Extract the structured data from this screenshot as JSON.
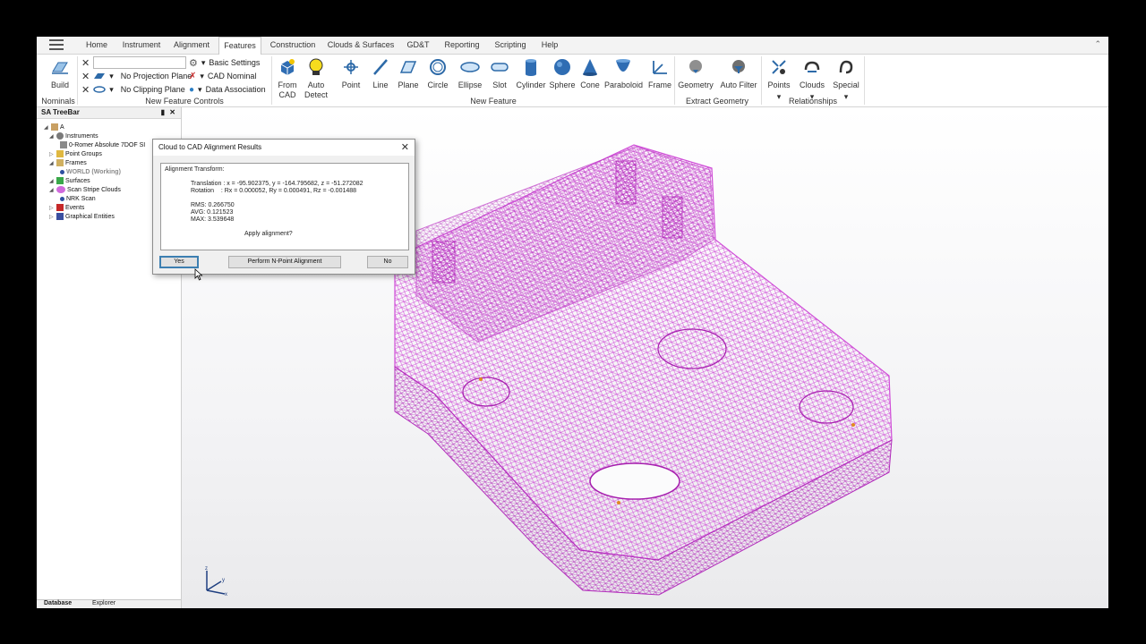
{
  "menu_tabs": [
    "Home",
    "Instrument",
    "Alignment",
    "Features",
    "Construction",
    "Clouds & Surfaces",
    "GD&T",
    "Reporting",
    "Scripting",
    "Help"
  ],
  "active_tab": "Features",
  "ribbon": {
    "build": {
      "label": "Build",
      "group": "Nominals"
    },
    "controls": {
      "group": "New Feature Controls",
      "projection": "No Projection Plane",
      "clipping": "No Clipping Plane",
      "basic_settings": "Basic Settings",
      "cad_nominal": "CAD Nominal",
      "data_association": "Data Association"
    },
    "new_feature": {
      "group": "New Feature",
      "from_cad": "From\nCAD",
      "auto_detect": "Auto\nDetect",
      "point": "Point",
      "line": "Line",
      "plane": "Plane",
      "circle": "Circle",
      "ellipse": "Ellipse",
      "slot": "Slot",
      "cylinder": "Cylinder",
      "sphere": "Sphere",
      "cone": "Cone",
      "paraboloid": "Paraboloid",
      "frame": "Frame"
    },
    "extract": {
      "group": "Extract Geometry",
      "geometry": "Geometry",
      "auto_filter": "Auto Filter"
    },
    "relationships": {
      "group": "Relationships",
      "points": "Points",
      "clouds": "Clouds",
      "special": "Special"
    }
  },
  "treebar": {
    "title": "SA TreeBar",
    "nodes": {
      "root": "A",
      "instruments": "Instruments",
      "romer": "0-Romer Absolute 7DOF SI",
      "point_groups": "Point Groups",
      "frames": "Frames",
      "world": "WORLD (Working)",
      "surfaces": "Surfaces",
      "scan_stripe": "Scan Stripe Clouds",
      "nrk_scan": "NRK Scan",
      "events": "Events",
      "graphical": "Graphical Entities"
    },
    "tabs": {
      "database": "Database",
      "explorer": "Explorer"
    }
  },
  "dialog": {
    "title": "Cloud to CAD Alignment Results",
    "heading": "Alignment Transform:",
    "translation": "Translation : x = -95.902375, y = -164.795682, z = -51.272082",
    "rotation": "Rotation    : Rx = 0.000052, Ry = 0.000491, Rz = -0.001488",
    "rms": "RMS: 0.266750",
    "avg": "AVG: 0.121523",
    "max": "MAX: 3.539648",
    "question": "Apply alignment?",
    "yes": "Yes",
    "n_point": "Perform N-Point Alignment",
    "no": "No"
  },
  "triad": {
    "z": "z",
    "x": "x",
    "y": "y"
  },
  "colors": {
    "mesh": "#d04fd8",
    "mesh_dark": "#a61fae",
    "accent": "#3c7fb1"
  }
}
